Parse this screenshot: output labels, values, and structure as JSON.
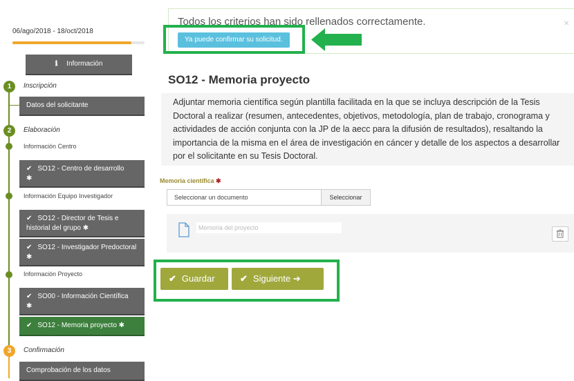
{
  "sidebar": {
    "dates": "06/ago/2018 - 18/oct/2018",
    "progress_fraction": 0.9,
    "info_button": "Información",
    "info_icon": "ℹ",
    "steps": [
      {
        "number": "1",
        "label": "Inscripción"
      },
      {
        "number": "2",
        "label": "Elaboración"
      },
      {
        "number": "3",
        "label": "Confirmación"
      }
    ],
    "sub_labels": [
      "Información Centro",
      "Información Equipo Investigador",
      "Información Proyecto"
    ],
    "items": {
      "datos_solicitante": "Datos del solicitante",
      "centro_desarrollo": "SO12 - Centro de desarrollo",
      "director_tesis": "SO12 - Director de Tesis e historial del grupo",
      "investigador": "SO12 - Investigador Predoctoral",
      "info_cientifica": "SO00 - Información Científica",
      "memoria": "SO12 - Memoria proyecto",
      "comprobacion": "Comprobación de los datos"
    },
    "check_glyph": "✔",
    "required_glyph": "✱"
  },
  "alert": {
    "text": "Todos los criterios han sido rellenados correctamente.",
    "button": "Ya puede confirmar su solicitud.",
    "close": "×"
  },
  "main": {
    "title": "SO12 - Memoria proyecto",
    "description": "Adjuntar memoria científica según plantilla facilitada en la que se incluya descripción de la Tesis Doctoral a realizar (resumen, antecedentes, objetivos, metodología, plan de trabajo, cronograma y actividades de acción conjunta con la JP de la aecc para la difusión de resultados), resaltando la importancia de la misma en el área de investigación en cáncer y detalle de los aspectos a desarrollar por el solicitante en su Tesis Doctoral.",
    "field_label": "Memoria científica",
    "file_placeholder": "Seleccionar un documento",
    "file_button": "Seleccionar",
    "document_name": "Memoria del proyecto",
    "save_button": "Guardar",
    "next_button": "Siguiente",
    "next_arrow": "➔"
  },
  "colors": {
    "highlight": "#22b14c",
    "nav_active": "#3d7f3d",
    "nav_default": "#666666",
    "action": "#a0a83c",
    "alert_button": "#5bc0de",
    "progress": "#f0a62b"
  }
}
